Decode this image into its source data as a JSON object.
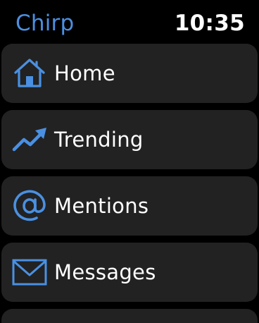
{
  "app": {
    "title": "Chirp",
    "time": "10:35"
  },
  "colors": {
    "accent": "#4a90e2",
    "tile_background": "#222222",
    "text": "#ffffff",
    "background": "#000000"
  },
  "menu": {
    "items": [
      {
        "label": "Home",
        "icon": "home-icon"
      },
      {
        "label": "Trending",
        "icon": "trending-icon"
      },
      {
        "label": "Mentions",
        "icon": "at-sign-icon"
      },
      {
        "label": "Messages",
        "icon": "envelope-icon"
      }
    ]
  }
}
